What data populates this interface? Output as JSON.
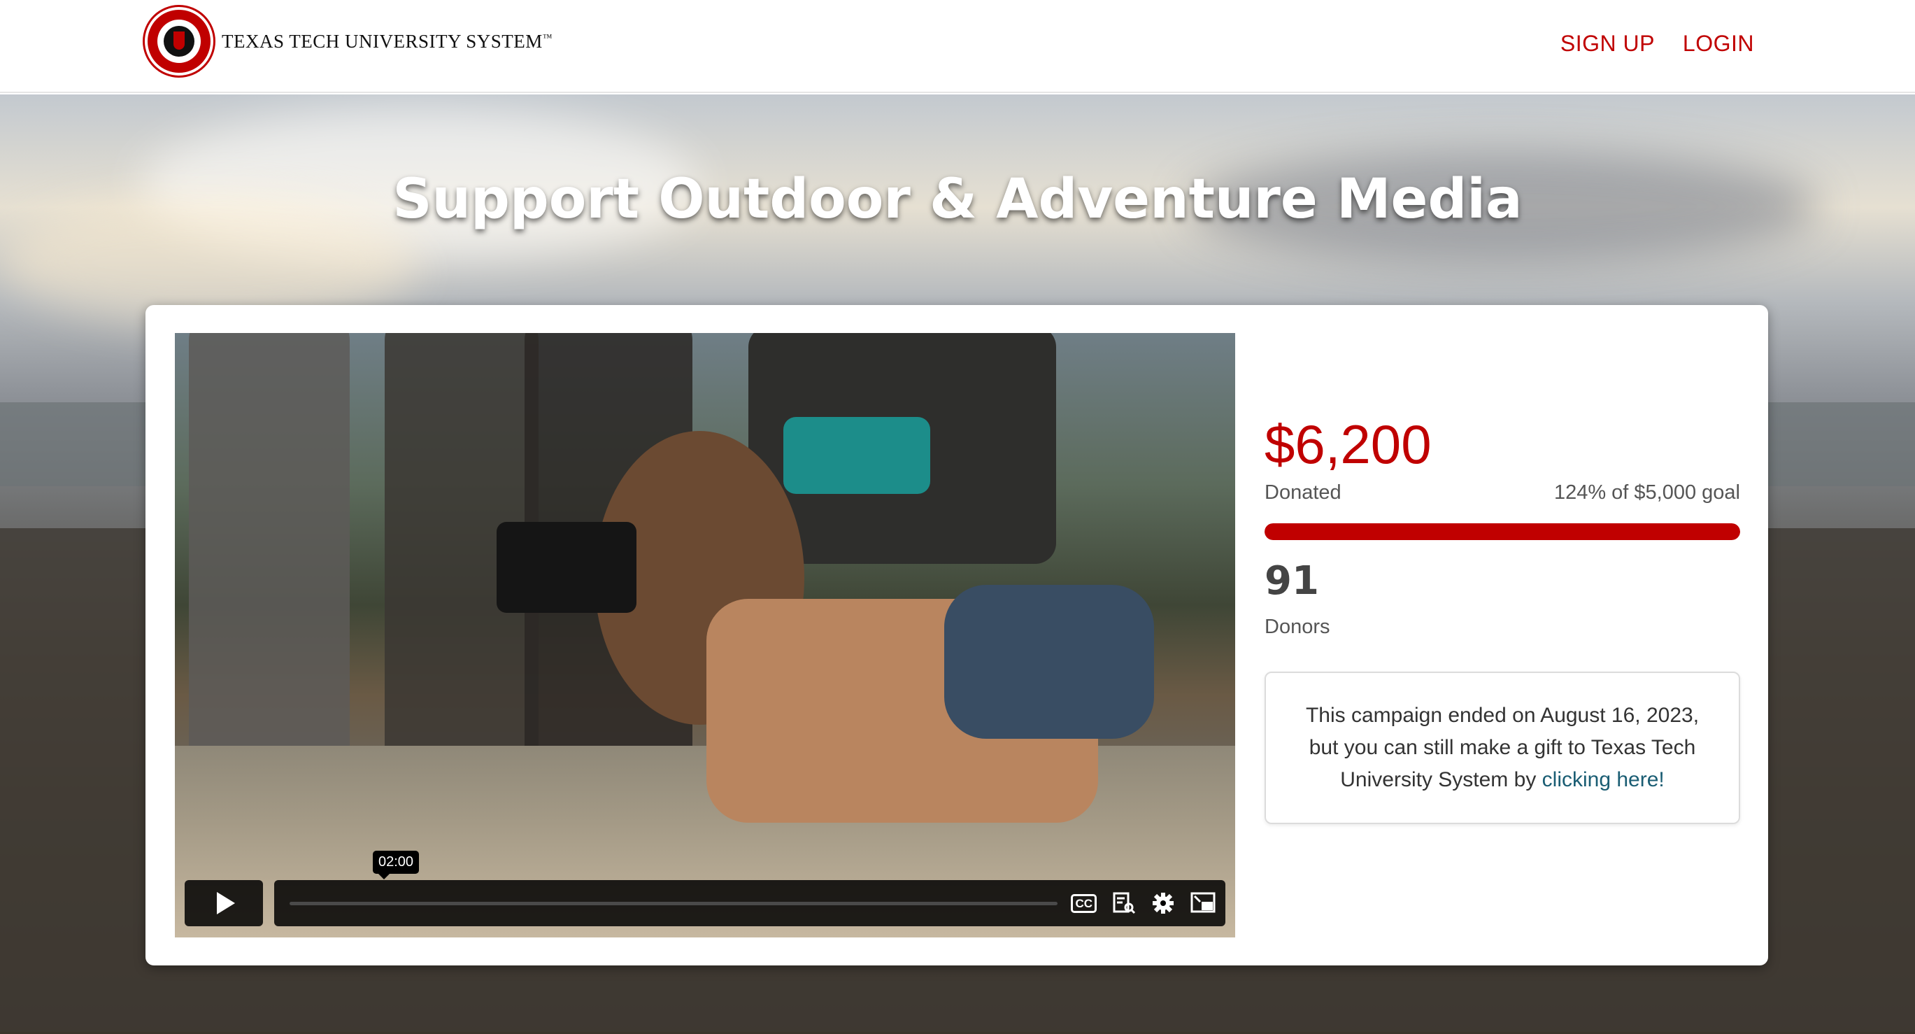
{
  "header": {
    "logo_text": "TEXAS TECH UNIVERSITY SYSTEM",
    "trademark": "™",
    "nav": {
      "sign_up": "SIGN UP",
      "login": "LOGIN"
    }
  },
  "hero": {
    "title": "Support Outdoor & Adventure Media"
  },
  "video": {
    "duration_tooltip": "02:00",
    "controls": [
      "play-icon",
      "captions-icon",
      "transcript-icon",
      "settings-icon",
      "picture-in-picture-icon"
    ]
  },
  "stats": {
    "amount": "$6,200",
    "donated_label": "Donated",
    "goal_label": "124% of $5,000 goal",
    "progress_percent": 100,
    "donors_count": "91",
    "donors_label": "Donors"
  },
  "notice": {
    "text": "This campaign ended on August 16, 2023, but you can still make a gift to Texas Tech University System by ",
    "link_text": "clicking here!"
  },
  "colors": {
    "brand_red": "#c00000",
    "link": "#1a5d73"
  }
}
